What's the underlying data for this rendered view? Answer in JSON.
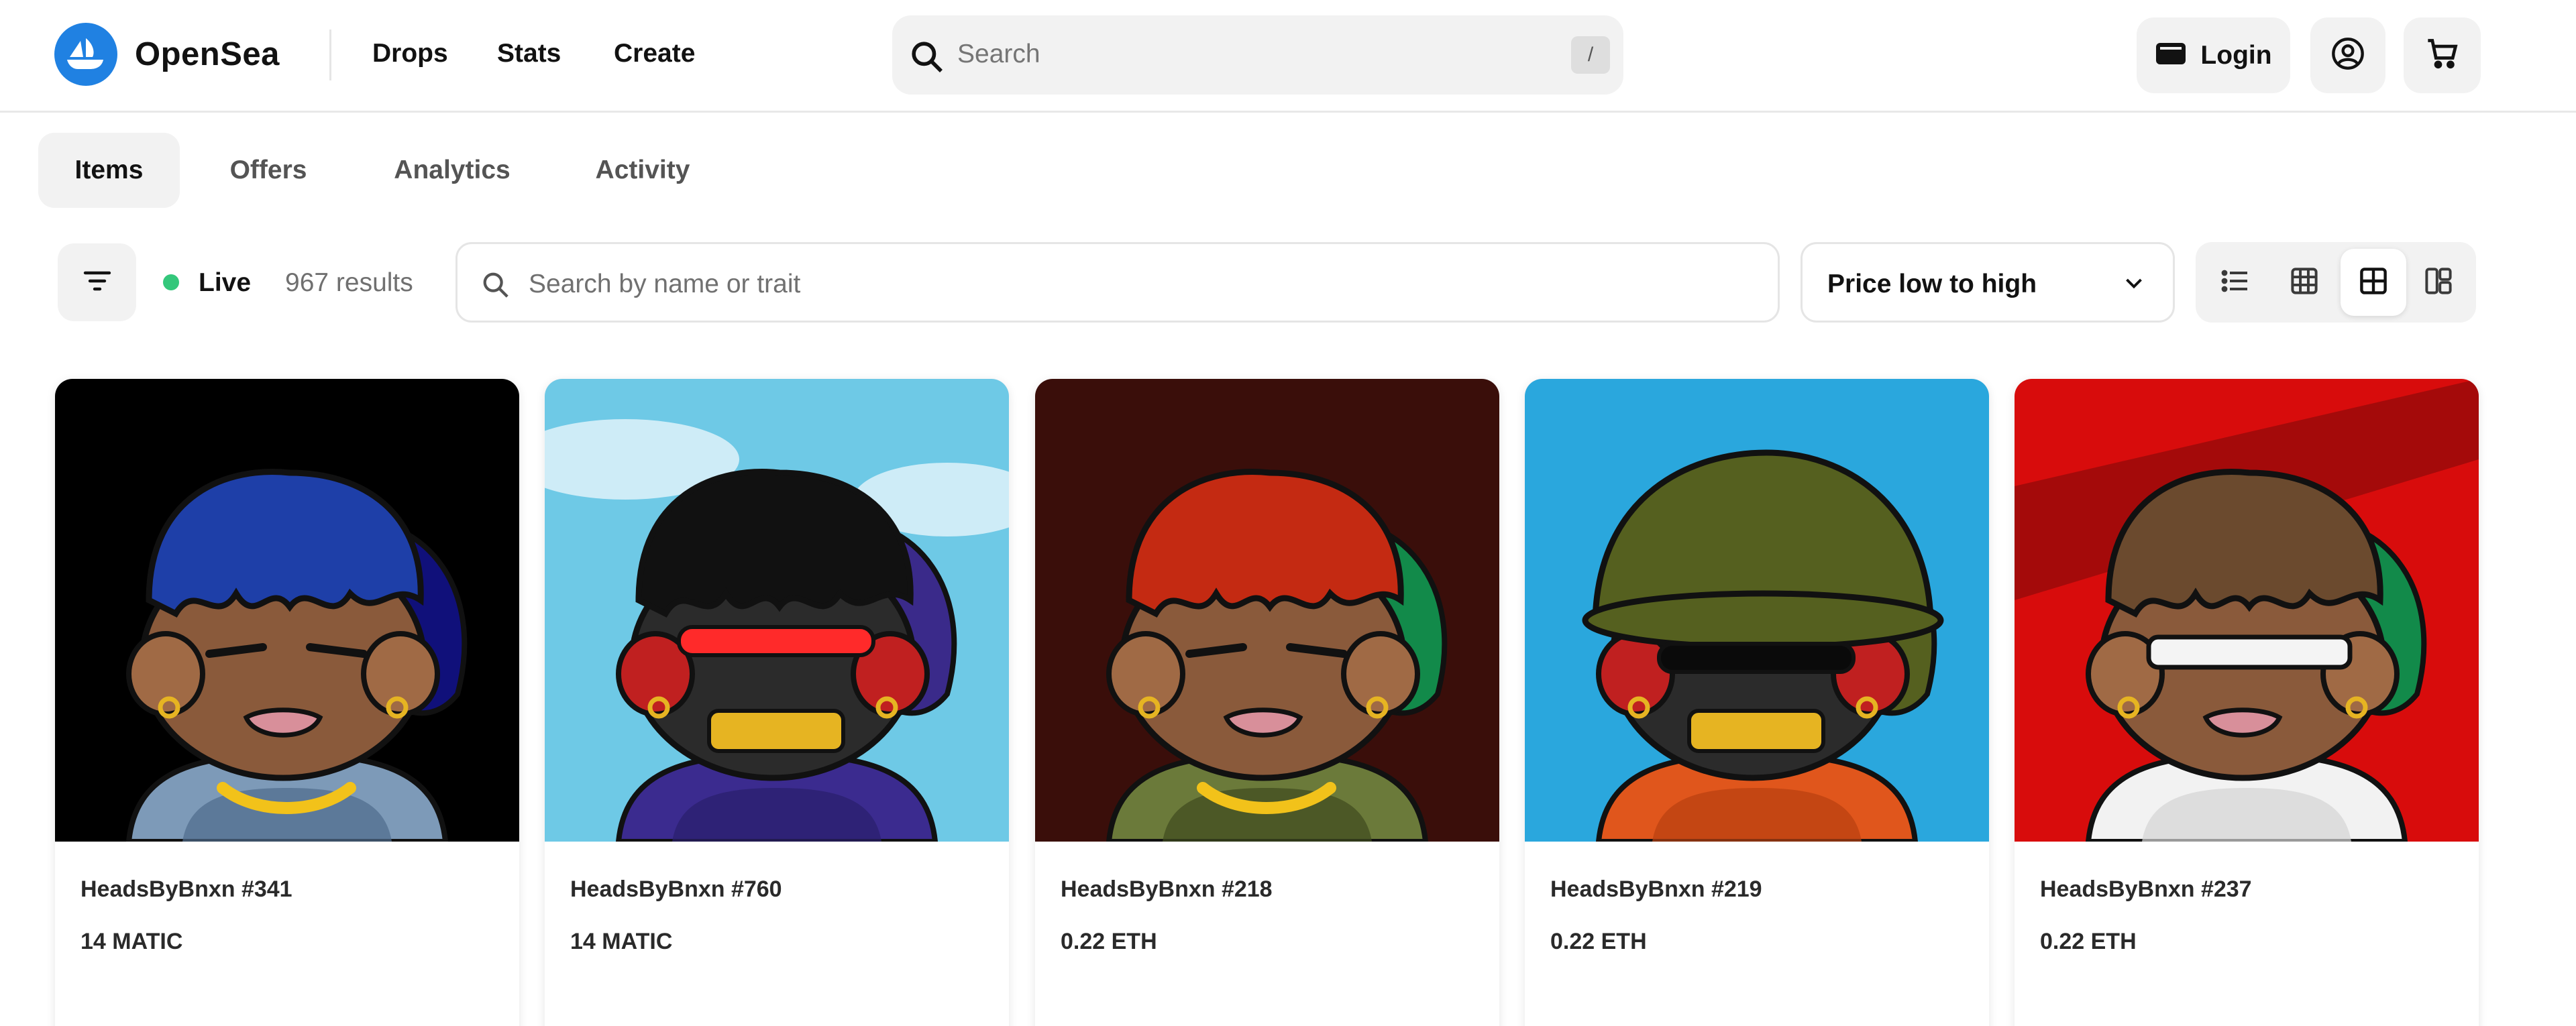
{
  "header": {
    "brand": "OpenSea",
    "nav": [
      {
        "label": "Drops"
      },
      {
        "label": "Stats"
      },
      {
        "label": "Create"
      }
    ],
    "search": {
      "placeholder": "Search",
      "shortcut": "/"
    },
    "login_label": "Login"
  },
  "tabs": [
    {
      "label": "Items",
      "active": true
    },
    {
      "label": "Offers",
      "active": false
    },
    {
      "label": "Analytics",
      "active": false
    },
    {
      "label": "Activity",
      "active": false
    }
  ],
  "toolbar": {
    "live_label": "Live",
    "live_color": "#34c77b",
    "results": "967 results",
    "search_placeholder": "Search by name or trait",
    "sort_selected": "Price low to high",
    "view_modes": [
      {
        "icon": "list-view-icon",
        "active": false
      },
      {
        "icon": "small-grid-icon",
        "active": false
      },
      {
        "icon": "large-grid-icon",
        "active": true
      },
      {
        "icon": "masonry-grid-icon",
        "active": false
      }
    ]
  },
  "items": [
    {
      "name": "HeadsByBnxn #341",
      "price": "14 MATIC",
      "bg": "#000000",
      "hair": "#1e3fa8",
      "hat": "#10107a",
      "outfit": "camo-blue"
    },
    {
      "name": "HeadsByBnxn #760",
      "price": "14 MATIC",
      "bg": "#6ec9e6",
      "hair": "#111111",
      "hat": "#3a2a8a",
      "outfit": "purple-hoodie"
    },
    {
      "name": "HeadsByBnxn #218",
      "price": "0.22 ETH",
      "bg": "#3a0e0a",
      "hair": "#c42a12",
      "hat": "#128a4a",
      "outfit": "camo-green"
    },
    {
      "name": "HeadsByBnxn #219",
      "price": "0.22 ETH",
      "bg": "#2aa7dd",
      "hair": "#6b4a2e",
      "hat": "#55601f",
      "outfit": "orange-jumpsuit"
    },
    {
      "name": "HeadsByBnxn #237",
      "price": "0.22 ETH",
      "bg": "#d80c0c",
      "hair": "#6b4a2e",
      "hat": "#128a4a",
      "outfit": "white-jacket"
    }
  ],
  "colors": {
    "brand_blue": "#2081e2",
    "surface": "#f2f2f2",
    "border": "#e5e5e5"
  }
}
